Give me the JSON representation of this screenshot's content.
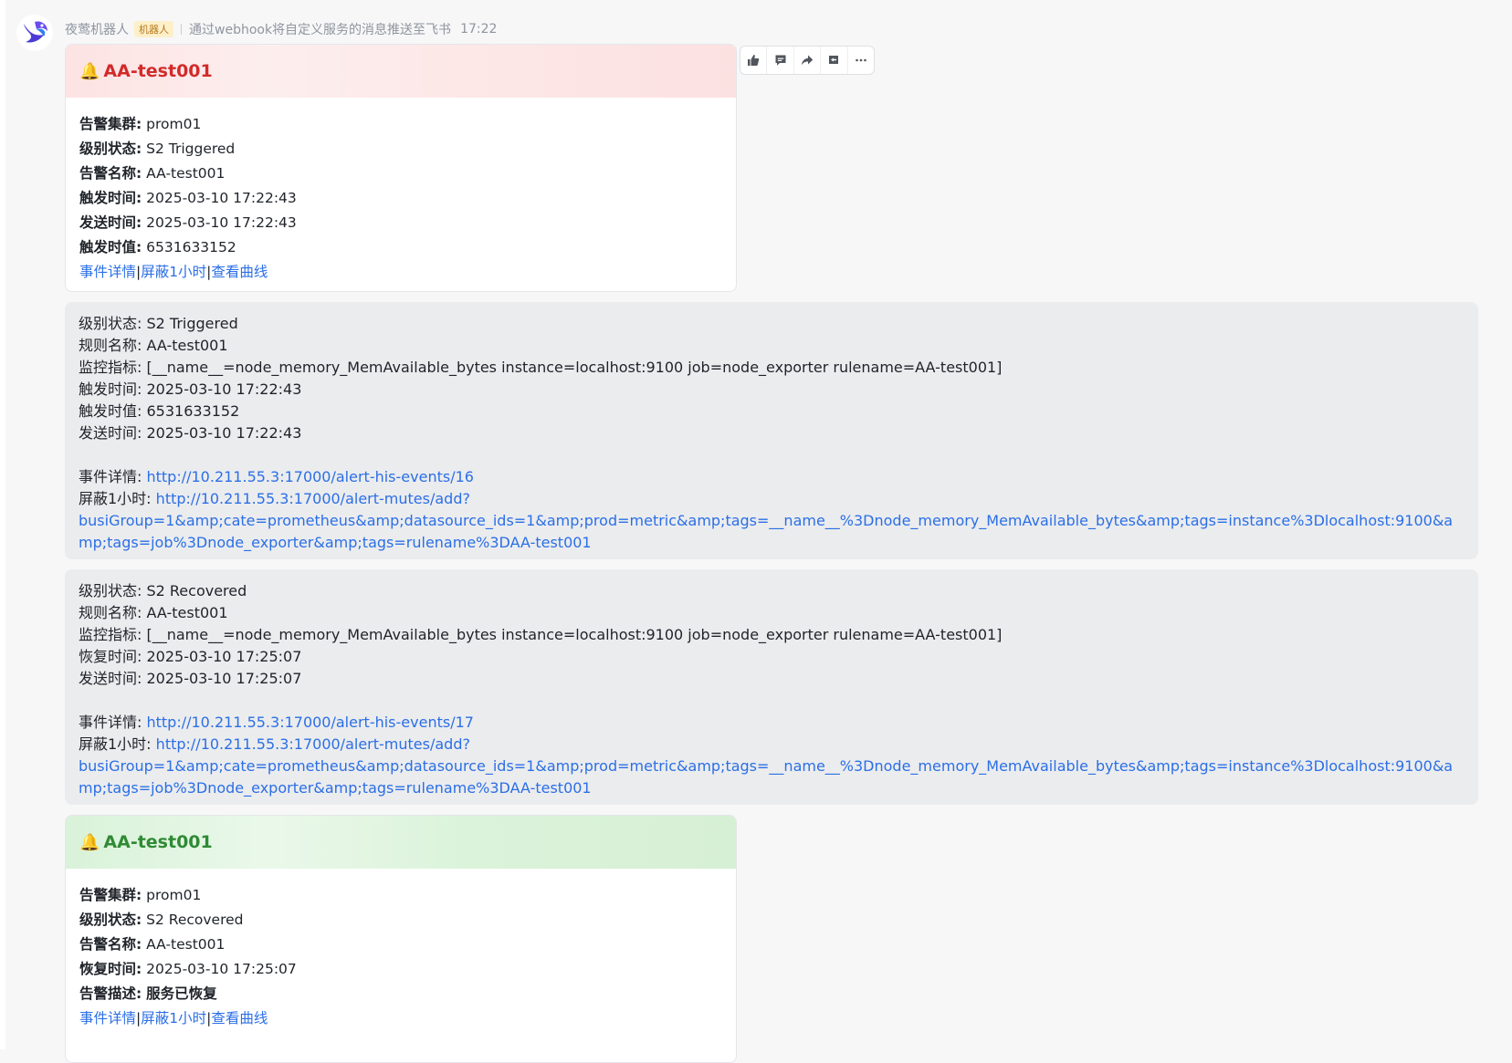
{
  "sender": {
    "name": "夜莺机器人",
    "badge": "机器人",
    "description": "通过webhook将自定义服务的消息推送至飞书",
    "time": "17:22",
    "avatar_icon": "nightingale-bird-logo"
  },
  "toolbar": {
    "icons": [
      "thumbs-up-icon",
      "comment-icon",
      "forward-icon",
      "reply-icon",
      "more-icon"
    ]
  },
  "card1": {
    "title": "AA-test001",
    "theme_color": "#d12b2b",
    "fields": [
      {
        "label": "告警集群:",
        "value": "prom01"
      },
      {
        "label": "级别状态:",
        "value": "S2 Triggered"
      },
      {
        "label": "告警名称:",
        "value": "AA-test001"
      },
      {
        "label": "触发时间:",
        "value": "2025-03-10 17:22:43"
      },
      {
        "label": "发送时间:",
        "value": "2025-03-10 17:22:43"
      },
      {
        "label": "触发时值:",
        "value": "6531633152"
      }
    ],
    "links": [
      "事件详情",
      "屏蔽1小时",
      "查看曲线"
    ],
    "link_sep": "|"
  },
  "msg1": {
    "lines": [
      "级别状态: S2 Triggered",
      "规则名称: AA-test001",
      "监控指标: [__name__=node_memory_MemAvailable_bytes instance=localhost:9100 job=node_exporter rulename=AA-test001]",
      "触发时间: 2025-03-10 17:22:43",
      "触发时值: 6531633152",
      "发送时间: 2025-03-10 17:22:43"
    ],
    "event_label": "事件详情: ",
    "event_url": "http://10.211.55.3:17000/alert-his-events/16",
    "mute_label": "屏蔽1小时: ",
    "mute_url_1": "http://10.211.55.3:17000/alert-mutes/add?",
    "mute_url_2": "busiGroup=1&amp;cate=prometheus&amp;datasource_ids=1&amp;prod=metric&amp;tags=__name__%3Dnode_memory_MemAvailable_bytes&amp;tags=instance%3Dlocalhost:9100&amp;tags=job%3Dnode_exporter&amp;tags=rulename%3DAA-test001"
  },
  "msg2": {
    "lines": [
      "级别状态: S2 Recovered",
      "规则名称: AA-test001",
      "监控指标: [__name__=node_memory_MemAvailable_bytes instance=localhost:9100 job=node_exporter rulename=AA-test001]",
      "恢复时间:  2025-03-10 17:25:07",
      "发送时间: 2025-03-10 17:25:07"
    ],
    "event_label": "事件详情: ",
    "event_url": "http://10.211.55.3:17000/alert-his-events/17",
    "mute_label": "屏蔽1小时: ",
    "mute_url_1": "http://10.211.55.3:17000/alert-mutes/add?",
    "mute_url_2": "busiGroup=1&amp;cate=prometheus&amp;datasource_ids=1&amp;prod=metric&amp;tags=__name__%3Dnode_memory_MemAvailable_bytes&amp;tags=instance%3Dlocalhost:9100&amp;tags=job%3Dnode_exporter&amp;tags=rulename%3DAA-test001"
  },
  "card2": {
    "title": "AA-test001",
    "theme_color": "#2f8a35",
    "fields": [
      {
        "label": "告警集群:",
        "value": "prom01"
      },
      {
        "label": "级别状态:",
        "value": "S2 Recovered"
      },
      {
        "label": "告警名称:",
        "value": "AA-test001"
      },
      {
        "label": "恢复时间:",
        "value": "2025-03-10 17:25:07"
      },
      {
        "label": "告警描述:",
        "value": "服务已恢复"
      }
    ],
    "links": [
      "事件详情",
      "屏蔽1小时",
      "查看曲线"
    ],
    "link_sep": "|"
  }
}
